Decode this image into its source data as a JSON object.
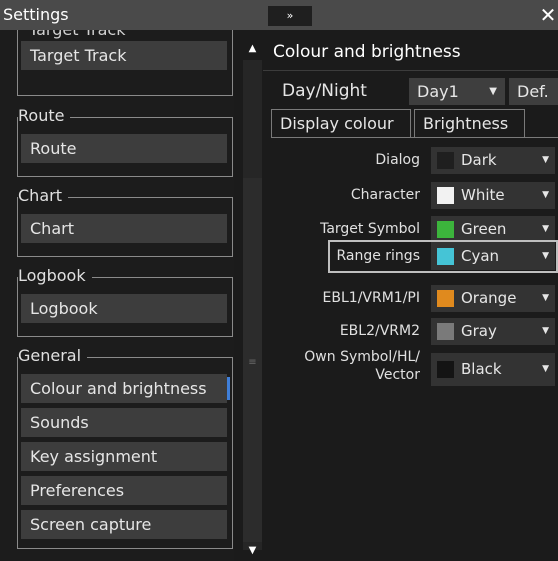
{
  "window": {
    "title": "Settings",
    "collapse_icon": "»",
    "close_icon": "✕"
  },
  "sidebar": {
    "partial_item": "Target Track",
    "groups": [
      {
        "label": "",
        "items": [
          {
            "label": "Target Track"
          }
        ]
      },
      {
        "label": "Route",
        "items": [
          {
            "label": "Route"
          }
        ]
      },
      {
        "label": "Chart",
        "items": [
          {
            "label": "Chart"
          }
        ]
      },
      {
        "label": "Logbook",
        "items": [
          {
            "label": "Logbook"
          }
        ]
      },
      {
        "label": "General",
        "items": [
          {
            "label": "Colour and brightness",
            "selected": true
          },
          {
            "label": "Sounds"
          },
          {
            "label": "Key assignment"
          },
          {
            "label": "Preferences"
          },
          {
            "label": "Screen capture"
          }
        ]
      }
    ]
  },
  "scrollbar": {
    "up_icon": "▲",
    "down_icon": "▼",
    "grip_icon": "≡"
  },
  "main": {
    "section_title": "Colour and brightness",
    "day_night": {
      "label": "Day/Night",
      "value": "Day1",
      "arrow": "▼",
      "default_button": "Def."
    },
    "tabs": [
      {
        "label": "Display colour",
        "active": true
      },
      {
        "label": "Brightness",
        "active": false
      }
    ],
    "color_rows": [
      {
        "label": "Dialog",
        "value": "Dark",
        "swatch": "#1f1f1f"
      },
      {
        "label": "Character",
        "value": "White",
        "swatch": "#f2f2f2"
      },
      {
        "label": "Target Symbol",
        "value": "Green",
        "swatch": "#3cb43c"
      },
      {
        "label": "Range rings",
        "value": "Cyan",
        "swatch": "#45c4d6",
        "highlighted": true
      },
      {
        "label": "EBL1/VRM1/PI",
        "value": "Orange",
        "swatch": "#e08a1e"
      },
      {
        "label": "EBL2/VRM2",
        "value": "Gray",
        "swatch": "#7a7a7a"
      },
      {
        "label_line1": "Own Symbol/HL/",
        "label_line2": "Vector",
        "value": "Black",
        "swatch": "#141414"
      }
    ],
    "arrow": "▼"
  },
  "colors": {
    "accent": "#3f7fd9",
    "item_bg": "#3d3d3d",
    "titlebar": "#4a4a4a"
  }
}
